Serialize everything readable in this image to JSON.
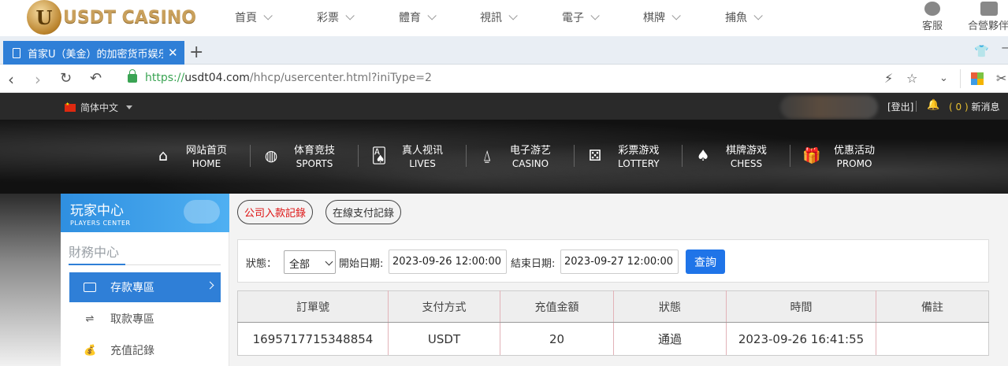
{
  "site_strip": {
    "logo_text": "USDT CASINO",
    "logo_mark": "U",
    "nav": [
      "首頁",
      "彩票",
      "體育",
      "視訊",
      "電子",
      "棋牌",
      "捕魚"
    ],
    "service_label": "客服",
    "partner_label": "合營夥伴"
  },
  "browser": {
    "tab_title": "首家U（美金）的加密货币娱乐",
    "url_scheme": "https://",
    "url_host": "usdt04.com",
    "url_path": "/hhcp/usercenter.html?iniType=2"
  },
  "site_header": {
    "language": "简体中文",
    "logout": "[登出]",
    "message_count": "( 0 )",
    "message_label": "新消息"
  },
  "main_nav": [
    {
      "zh": "网站首页",
      "en": "HOME",
      "icon": "home-icon"
    },
    {
      "zh": "体育竞技",
      "en": "SPORTS",
      "icon": "basketball-icon"
    },
    {
      "zh": "真人视讯",
      "en": "LIVES",
      "icon": "cards-icon"
    },
    {
      "zh": "电子游艺",
      "en": "CASINO",
      "icon": "joystick-icon"
    },
    {
      "zh": "彩票游戏",
      "en": "LOTTERY",
      "icon": "dice-icon"
    },
    {
      "zh": "棋牌游戏",
      "en": "CHESS",
      "icon": "spade-icon"
    },
    {
      "zh": "优惠活动",
      "en": "PROMO",
      "icon": "gift-icon"
    }
  ],
  "sidebar": {
    "title_zh": "玩家中心",
    "title_en": "PLAYERS CENTER",
    "section": "財務中心",
    "items": [
      {
        "label": "存款專區",
        "active": true,
        "icon": "card-icon"
      },
      {
        "label": "取款專區",
        "active": false,
        "icon": "withdraw-icon"
      },
      {
        "label": "充值記錄",
        "active": false,
        "icon": "moneybag-icon"
      }
    ]
  },
  "tabs": [
    "公司入款記錄",
    "在線支付記錄"
  ],
  "filter": {
    "status_label": "狀態：",
    "status_value": "全部",
    "start_label": "開始日期:",
    "start_value": "2023-09-26 12:00:00",
    "end_label": "結束日期:",
    "end_value": "2023-09-27 12:00:00",
    "query_label": "查詢"
  },
  "table": {
    "columns": [
      "訂單號",
      "支付方式",
      "充值金額",
      "狀態",
      "時間",
      "備註"
    ],
    "rows": [
      [
        "1695717715348854",
        "USDT",
        "20",
        "通過",
        "2023-09-26 16:41:55",
        ""
      ]
    ]
  },
  "colors": {
    "accent": "#2f7fd7",
    "query_button": "#1f74e8",
    "active_tab_text": "#dd1111",
    "url_secure": "#3aa453"
  }
}
